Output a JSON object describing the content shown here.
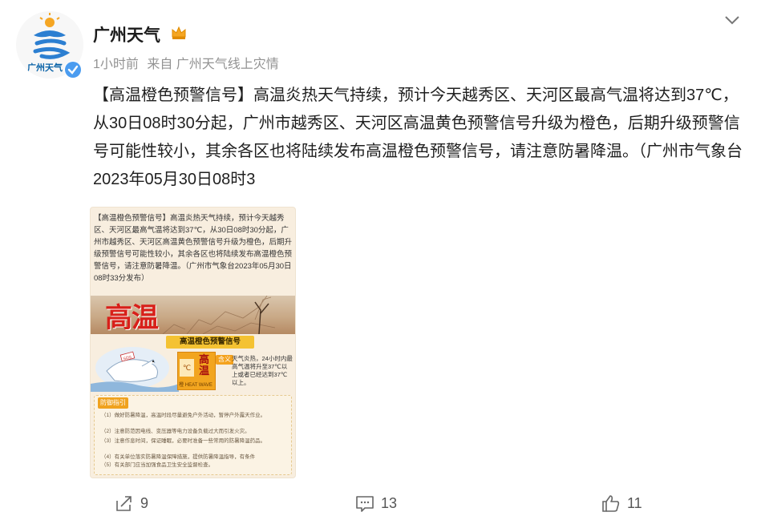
{
  "author": {
    "name": "广州天气",
    "avatar_label": "广州天气",
    "badge_icon": "crown-icon",
    "verified_icon": "verified-icon"
  },
  "meta": {
    "time": "1小时前",
    "source": "来自 广州天气线上灾情"
  },
  "post": {
    "text": "【高温橙色预警信号】高温炎热天气持续，预计今天越秀区、天河区最高气温将达到37℃，从30日08时30分起，广州市越秀区、天河区高温黄色预警信号升级为橙色，后期升级预警信号可能性较小，其余各区也将陆续发布高温橙色预警信号，请注意防暑降温。（广州市气象台2023年05月30日08时3"
  },
  "image": {
    "text": "【高温橙色预警信号】高温炎热天气持续，预计今天越秀区、天河区最高气温将达到37℃，从30日08时30分起，广州市越秀区、天河区高温黄色预警信号升级为橙色，后期升级预警信号可能性较小，其余各区也将陆续发布高温橙色预警信号，请注意防暑降温。（广州市气象台2023年05月30日08时33分发布）",
    "big_title": "高温",
    "warning_title": "高温橙色预警信号",
    "sign_celsius": "℃",
    "sign_title": "高温",
    "sign_label_cn": "橙",
    "sign_label_en": "HEAT WAVE",
    "definition_tag": "含义",
    "definition": "天气炎热，24小时内最高气温将升至37℃以上或者已经达到37℃以上。",
    "guide_tag": "防御指引",
    "guide_lines": [
      "（1）做好防暑降温，高温时段尽量避免户外活动，暂停户外露天作业。",
      "（2）注意防范因电线、变压器等电力设备负载过大而引发火灾。",
      "（3）注意作息时间，保证睡眠，必要时准备一些常用的防暑降温药品。",
      "（4）有关单位落实防暑降温保障措施，提供防暑降温指导，有条件",
      "（5）有关部门应当加强食品卫生安全监督检查。"
    ]
  },
  "actions": {
    "share_count": "9",
    "comment_count": "13",
    "like_count": "11"
  },
  "colors": {
    "accent_red": "#d8201a",
    "warning_yellow": "#f4c232",
    "sign_orange": "#f2a51f",
    "meta_gray": "#939393"
  }
}
